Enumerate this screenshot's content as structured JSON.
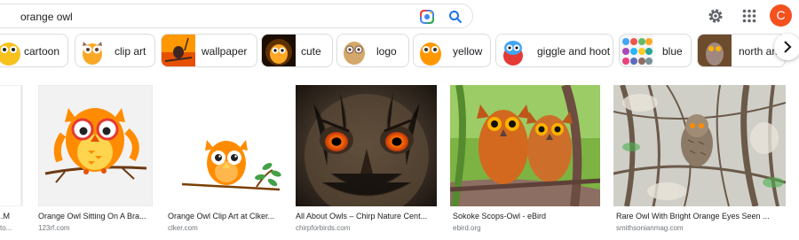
{
  "search": {
    "query": "orange owl"
  },
  "header": {
    "avatar_letter": "C"
  },
  "chips": [
    {
      "label": "cartoon"
    },
    {
      "label": "clip art"
    },
    {
      "label": "wallpaper"
    },
    {
      "label": "cute"
    },
    {
      "label": "logo"
    },
    {
      "label": "yellow"
    },
    {
      "label": "giggle and hoot"
    },
    {
      "label": "blue"
    },
    {
      "label": "north am"
    }
  ],
  "results": [
    {
      "title": "...M",
      "source": "sto..."
    },
    {
      "title": "Orange Owl Sitting On A Bra...",
      "source": "123rf.com"
    },
    {
      "title": "Orange Owl Clip Art at Clker...",
      "source": "clker.com"
    },
    {
      "title": "All About Owls – Chirp Nature Cent...",
      "source": "chirpforbirds.com"
    },
    {
      "title": "Sokoke Scops-Owl - eBird",
      "source": "ebird.org"
    },
    {
      "title": "Rare Owl With Bright Orange Eyes Seen ...",
      "source": "smithsonianmag.com"
    }
  ],
  "colors": {
    "accent": "#1a73e8",
    "avatar": "#f4511e",
    "owl_orange": "#ff8c00"
  }
}
